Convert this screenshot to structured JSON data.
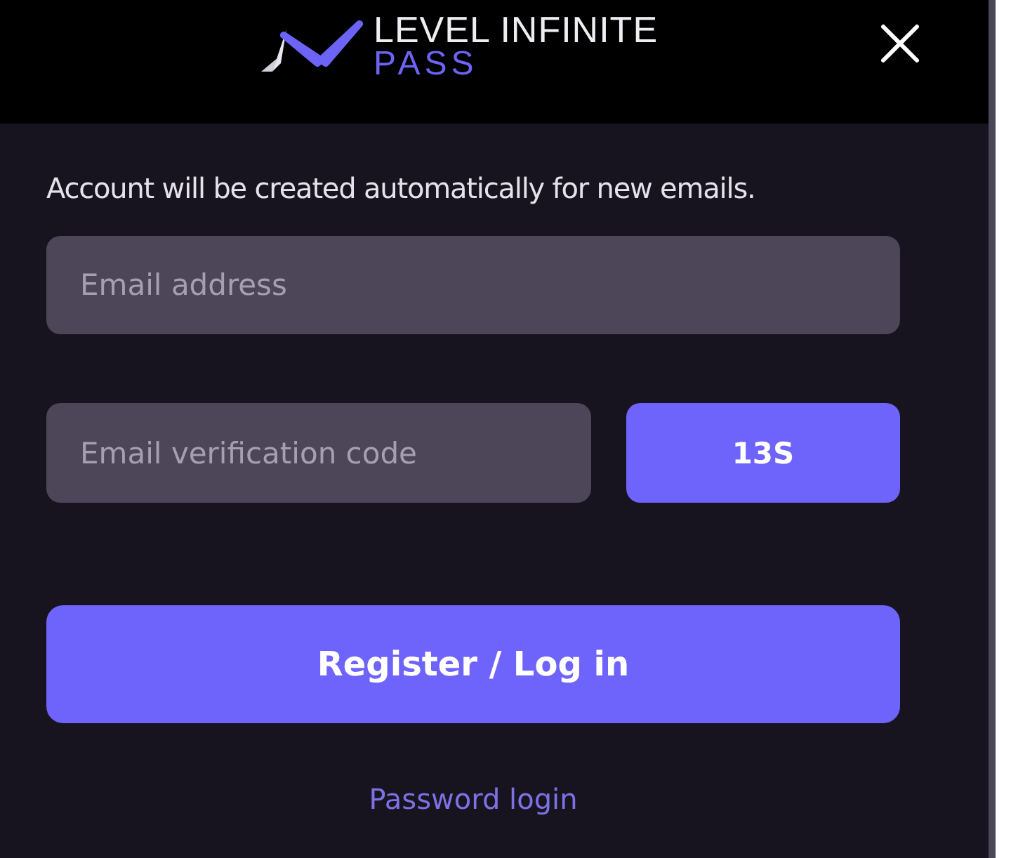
{
  "header": {
    "logo_title": "LEVEL INFINITE",
    "logo_subtitle": "PASS"
  },
  "notice": "Account will be created automatically for new emails.",
  "email_field": {
    "placeholder": "Email address"
  },
  "code_field": {
    "placeholder": "Email verification code"
  },
  "code_button": {
    "label": "13S"
  },
  "submit_button": {
    "label": "Register / Log in"
  },
  "password_login_link": "Password login"
}
